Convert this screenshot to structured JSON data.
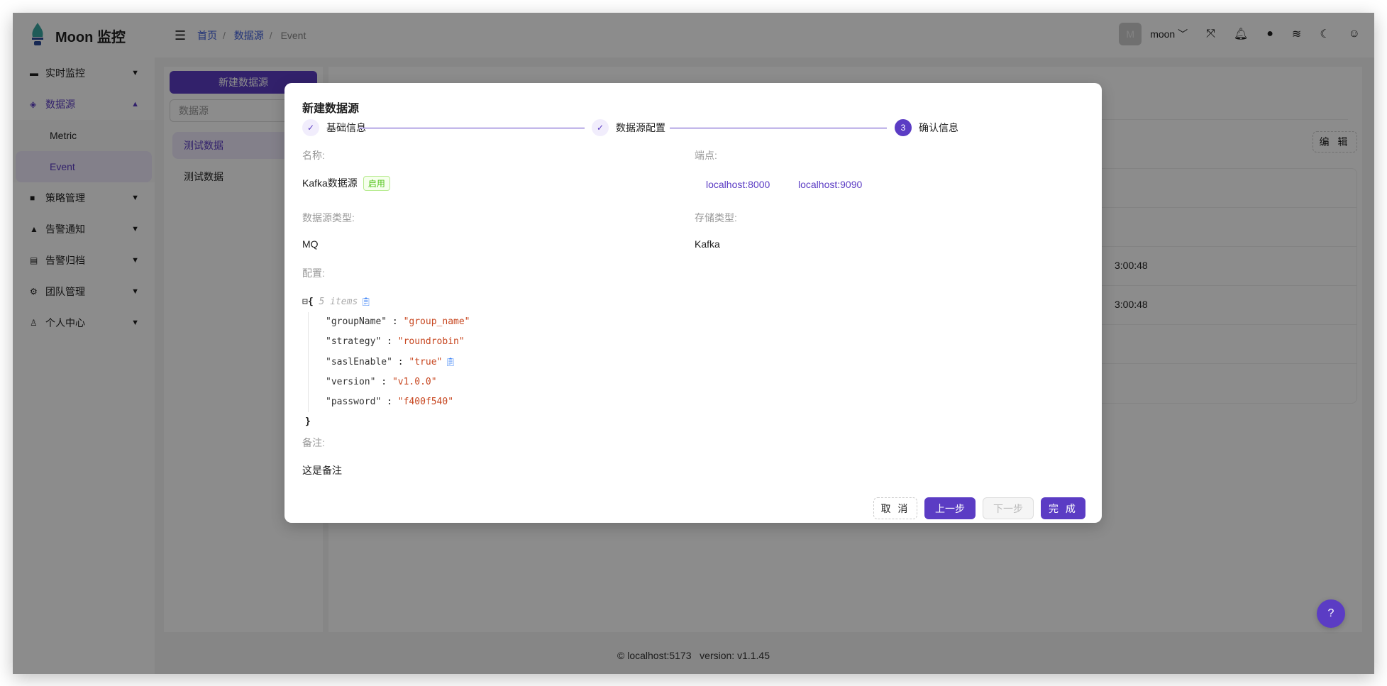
{
  "header": {
    "brand": "Moon 监控",
    "breadcrumb": [
      "首页",
      "数据源",
      "Event"
    ],
    "user_initial": "M",
    "user_name": "moon"
  },
  "sidebar": {
    "items": [
      {
        "label": "实时监控",
        "icon": "monitor-icon"
      },
      {
        "label": "数据源",
        "icon": "layers-icon",
        "expanded": true,
        "children": [
          "Metric",
          "Event"
        ]
      },
      {
        "label": "策略管理",
        "icon": "book-icon"
      },
      {
        "label": "告警通知",
        "icon": "bell-icon"
      },
      {
        "label": "告警归档",
        "icon": "archive-icon"
      },
      {
        "label": "团队管理",
        "icon": "gear-icon"
      },
      {
        "label": "个人中心",
        "icon": "user-icon"
      }
    ]
  },
  "list": {
    "new_button": "新建数据源",
    "search_placeholder": "数据源",
    "items": [
      "测试数据",
      "测试数据"
    ]
  },
  "main": {
    "edit_button": "编 辑",
    "timestamps": [
      "3:00:48",
      "3:00:48"
    ]
  },
  "footer": {
    "host": "localhost:5173",
    "version": "version: v1.1.45"
  },
  "modal": {
    "title": "新建数据源",
    "steps": [
      {
        "label": "基础信息",
        "status": "done"
      },
      {
        "label": "数据源配置",
        "status": "done"
      },
      {
        "label": "确认信息",
        "status": "current",
        "number": "3"
      }
    ],
    "name_label": "名称:",
    "name": "Kafka数据源",
    "status_tag": "启用",
    "endpoint_label": "端点:",
    "endpoints": [
      "localhost:8000",
      "localhost:9090"
    ],
    "type_label": "数据源类型:",
    "type": "MQ",
    "storage_label": "存储类型:",
    "storage": "Kafka",
    "config_label": "配置:",
    "config_meta": "5 items",
    "config": [
      {
        "k": "\"groupName\"",
        "v": "\"group_name\""
      },
      {
        "k": "\"strategy\"",
        "v": "\"roundrobin\""
      },
      {
        "k": "\"saslEnable\"",
        "v": "\"true\""
      },
      {
        "k": "\"version\"",
        "v": "\"v1.0.0\""
      },
      {
        "k": "\"password\"",
        "v": "\"f400f540\""
      }
    ],
    "remark_label": "备注:",
    "remark": "这是备注",
    "buttons": {
      "cancel": "取 消",
      "prev": "上一步",
      "next": "下一步",
      "done": "完 成"
    }
  },
  "colors": {
    "accent": "#5b3cc4",
    "string": "#c7461f",
    "success": "#52c41a"
  }
}
